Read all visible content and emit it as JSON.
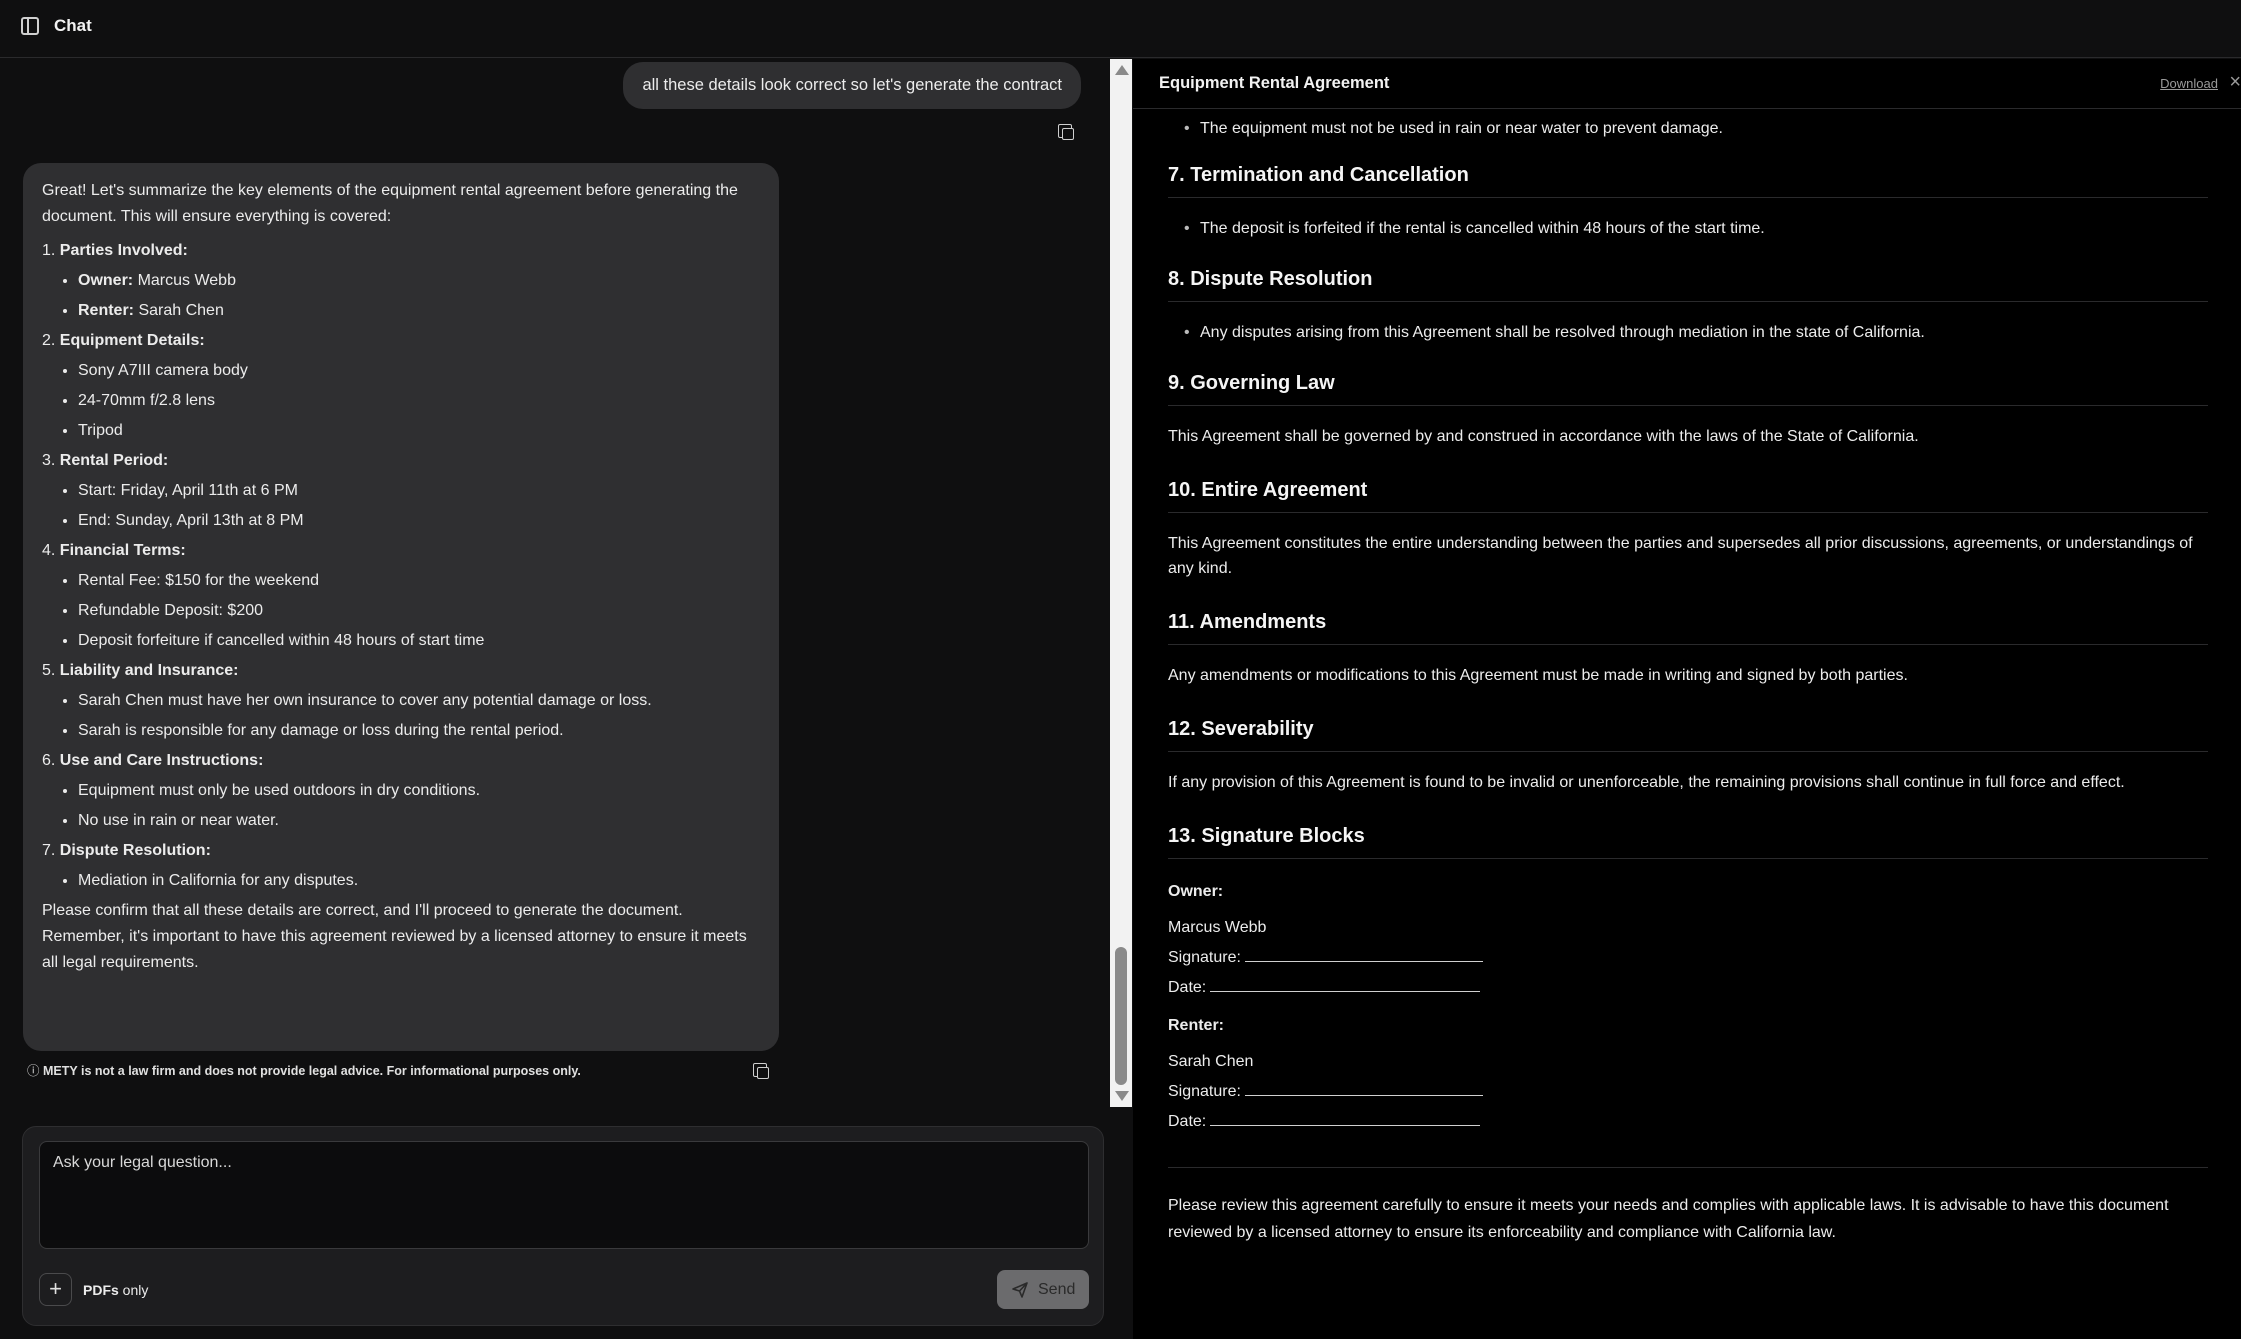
{
  "topbar": {
    "title": "Chat"
  },
  "chat": {
    "user_message": "all these details look correct so let's generate the contract",
    "assistant": {
      "intro": "Great! Let's summarize the key elements of the equipment rental agreement before generating the document. This will ensure everything is covered:",
      "sections": [
        {
          "num": "1.",
          "title": "Parties Involved:",
          "items": [
            {
              "bold": "Owner:",
              "text": " Marcus Webb"
            },
            {
              "bold": "Renter:",
              "text": " Sarah Chen"
            }
          ]
        },
        {
          "num": "2.",
          "title": "Equipment Details:",
          "items": [
            {
              "bold": "",
              "text": "Sony A7III camera body"
            },
            {
              "bold": "",
              "text": "24-70mm f/2.8 lens"
            },
            {
              "bold": "",
              "text": "Tripod"
            }
          ]
        },
        {
          "num": "3.",
          "title": "Rental Period:",
          "items": [
            {
              "bold": "",
              "text": "Start: Friday, April 11th at 6 PM"
            },
            {
              "bold": "",
              "text": "End: Sunday, April 13th at 8 PM"
            }
          ]
        },
        {
          "num": "4.",
          "title": "Financial Terms:",
          "items": [
            {
              "bold": "",
              "text": "Rental Fee: $150 for the weekend"
            },
            {
              "bold": "",
              "text": "Refundable Deposit: $200"
            },
            {
              "bold": "",
              "text": "Deposit forfeiture if cancelled within 48 hours of start time"
            }
          ]
        },
        {
          "num": "5.",
          "title": "Liability and Insurance:",
          "items": [
            {
              "bold": "",
              "text": "Sarah Chen must have her own insurance to cover any potential damage or loss."
            },
            {
              "bold": "",
              "text": "Sarah is responsible for any damage or loss during the rental period."
            }
          ]
        },
        {
          "num": "6.",
          "title": "Use and Care Instructions:",
          "items": [
            {
              "bold": "",
              "text": "Equipment must only be used outdoors in dry conditions."
            },
            {
              "bold": "",
              "text": "No use in rain or near water."
            }
          ]
        },
        {
          "num": "7.",
          "title": "Dispute Resolution:",
          "items": [
            {
              "bold": "",
              "text": "Mediation in California for any disputes."
            }
          ]
        }
      ],
      "closing": "Please confirm that all these details are correct, and I'll proceed to generate the document. Remember, it's important to have this agreement reviewed by a licensed attorney to ensure it meets all legal requirements."
    },
    "disclaimer_icon": "ⓘ",
    "disclaimer": "METY is not a law firm and does not provide legal advice. For informational purposes only."
  },
  "composer": {
    "placeholder": "Ask your legal question...",
    "attach_label": "+",
    "pdfs_bold": "PDFs",
    "pdfs_rest": " only",
    "send_label": "Send"
  },
  "document": {
    "title": "Equipment Rental Agreement",
    "download_label": "Download",
    "close_label": "×",
    "top_bullet": "The equipment must not be used in rain or near water to prevent damage.",
    "s7_title": "7. Termination and Cancellation",
    "s7_bullet": "The deposit is forfeited if the rental is cancelled within 48 hours of the start time.",
    "s8_title": "8. Dispute Resolution",
    "s8_bullet": "Any disputes arising from this Agreement shall be resolved through mediation in the state of California.",
    "s9_title": "9. Governing Law",
    "s9_text": "This Agreement shall be governed by and construed in accordance with the laws of the State of California.",
    "s10_title": "10. Entire Agreement",
    "s10_text": "This Agreement constitutes the entire understanding between the parties and supersedes all prior discussions, agreements, or understandings of any kind.",
    "s11_title": "11. Amendments",
    "s11_text": "Any amendments or modifications to this Agreement must be made in writing and signed by both parties.",
    "s12_title": "12. Severability",
    "s12_text": "If any provision of this Agreement is found to be invalid or unenforceable, the remaining provisions shall continue in full force and effect.",
    "s13_title": "13. Signature Blocks",
    "owner_label": "Owner:",
    "owner_name": "Marcus Webb",
    "renter_label": "Renter:",
    "renter_name": "Sarah Chen",
    "signature_label": "Signature:",
    "date_label": "Date:",
    "footer_text": "Please review this agreement carefully to ensure it meets your needs and complies with applicable laws. It is advisable to have this document reviewed by a licensed attorney to ensure its enforceability and compliance with California law."
  }
}
